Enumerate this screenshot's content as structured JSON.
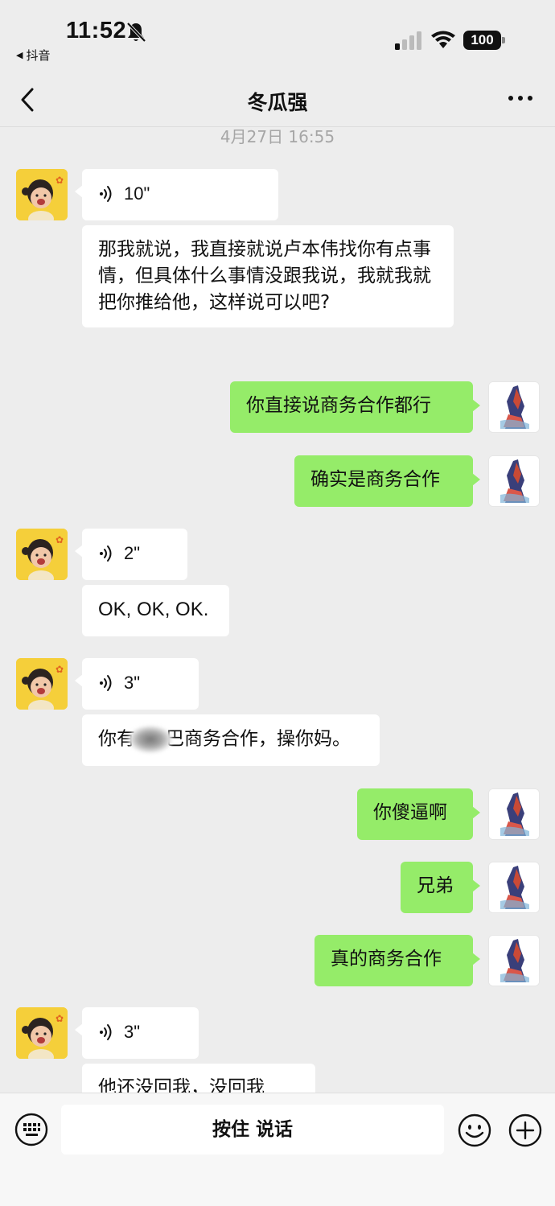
{
  "status_bar": {
    "time": "11:52",
    "back_app": "抖音",
    "battery": "100"
  },
  "header": {
    "title": "冬瓜强"
  },
  "timestamp": "4月27日 16:55",
  "messages": [
    {
      "voice": "10\""
    },
    {
      "text": "那我就说，我直接就说卢本伟找你有点事情，但具体什么事情没跟我说，我就我就把你推给他，这样说可以吧?"
    },
    {
      "text": "你直接说商务合作都行"
    },
    {
      "text": "确实是商务合作"
    },
    {
      "voice": "2\""
    },
    {
      "text": "OK, OK, OK."
    },
    {
      "voice": "3\""
    },
    {
      "text_a": "你有",
      "text_b": "巴商务合作，操你妈。"
    },
    {
      "text": "你傻逼啊"
    },
    {
      "text": "兄弟"
    },
    {
      "text": "真的商务合作"
    },
    {
      "voice": "3\""
    },
    {
      "text": "他还没回我，没回我"
    }
  ],
  "bottom_bar": {
    "hold_to_talk": "按住 说话"
  },
  "colors": {
    "background": "#ededed",
    "sent_bubble": "#95ec69",
    "received_bubble": "#ffffff",
    "avatar_left_bg": "#f5cf3a"
  }
}
